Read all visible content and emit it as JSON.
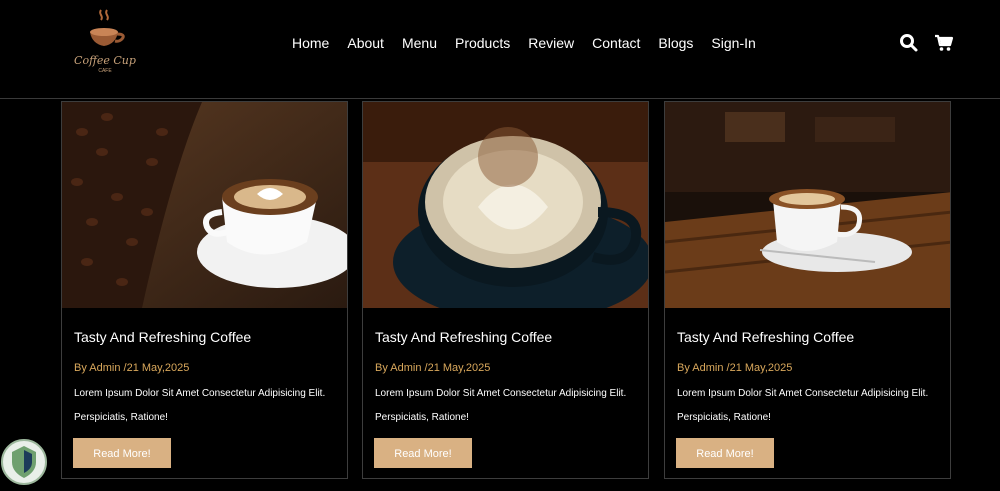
{
  "header": {
    "logo_text": "Coffee Cup",
    "logo_subtext": "CAFE",
    "nav_items": [
      "Home",
      "About",
      "Menu",
      "Products",
      "Review",
      "Contact",
      "Blogs",
      "Sign-In"
    ],
    "icons": [
      "search-icon",
      "cart-icon"
    ]
  },
  "cards": [
    {
      "title": "Tasty And Refreshing Coffee",
      "meta": "By Admin /21 May,2025",
      "desc1": "Lorem Ipsum Dolor Sit Amet Consectetur Adipisicing Elit.",
      "desc2": "Perspiciatis, Ratione!",
      "button": "Read More!"
    },
    {
      "title": "Tasty And Refreshing Coffee",
      "meta": "By Admin /21 May,2025",
      "desc1": "Lorem Ipsum Dolor Sit Amet Consectetur Adipisicing Elit.",
      "desc2": "Perspiciatis, Ratione!",
      "button": "Read More!"
    },
    {
      "title": "Tasty And Refreshing Coffee",
      "meta": "By Admin /21 May,2025",
      "desc1": "Lorem Ipsum Dolor Sit Amet Consectetur Adipisicing Elit.",
      "desc2": "Perspiciatis, Ratione!",
      "button": "Read More!"
    }
  ],
  "colors": {
    "accent": "#d9b183",
    "meta": "#d9a85c",
    "background": "#000000"
  }
}
